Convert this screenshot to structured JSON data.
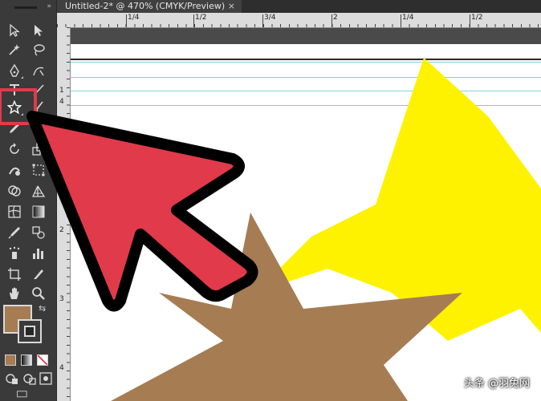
{
  "document_tab": {
    "title": "Untitled-2* @ 470% (CMYK/Preview)",
    "close_label": "×"
  },
  "ruler_top": {
    "labels": [
      "1/4",
      "1/2",
      "3/4",
      "2",
      "1/4",
      "1/2"
    ]
  },
  "ruler_left": {
    "labels": [
      "1",
      "4",
      "1",
      "2",
      "3",
      "4"
    ]
  },
  "toolbar": {
    "tools": [
      "selection-tool",
      "direct-selection-tool",
      "magic-wand-tool",
      "lasso-tool",
      "pen-tool",
      "curvature-tool",
      "type-tool",
      "line-segment-tool",
      "star-tool",
      "paintbrush-tool",
      "pencil-tool",
      "eraser-tool",
      "rotate-tool",
      "scale-tool",
      "warp-tool",
      "free-transform-tool",
      "shape-builder-tool",
      "perspective-grid-tool",
      "mesh-tool",
      "gradient-tool",
      "eyedropper-tool",
      "blend-tool",
      "symbol-sprayer-tool",
      "column-graph-tool",
      "artboard-tool",
      "slice-tool",
      "hand-tool",
      "zoom-tool"
    ],
    "fill_color": "#a67c52",
    "stroke_color": "#262626"
  },
  "colors": {
    "highlight": "#e13a4a",
    "arrow_fill": "#e13a4a",
    "yellow_star": "#fff200",
    "brown_star": "#a67c52",
    "guide": "#7fd4e3"
  },
  "watermark": {
    "text": "头条 @羽兔网"
  }
}
